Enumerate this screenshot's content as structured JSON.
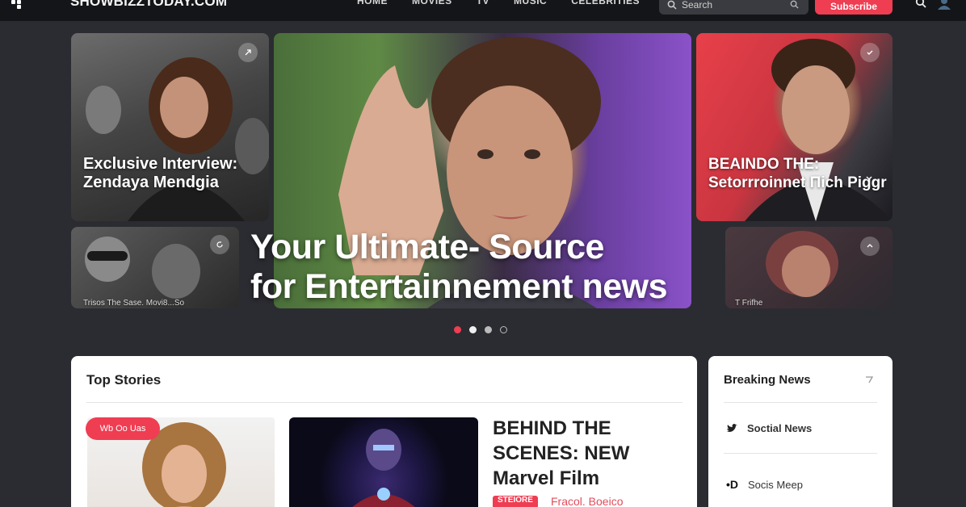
{
  "header": {
    "brand": "SHOWBIZZTODAY.COM",
    "nav": [
      "HOME",
      "MOVIES",
      "TV",
      "MUSIC",
      "CELEBRITIES"
    ],
    "search_placeholder": "Search",
    "subscribe_label": "Subscribe"
  },
  "hero": {
    "tiles": [
      {
        "title": "Exclusive Interview:  Zendaya Mendgia"
      },
      {
        "title": "BEAINDO THE: Setorrroinnet Πich Piggr"
      },
      {
        "caption": "Trisos The Sase. Movi8...So"
      },
      {
        "caption": "T Frifhe"
      }
    ],
    "headline_line1": "Your Ultimate- Source",
    "headline_line2": "for Entertainnement news",
    "carousel_total": 4,
    "carousel_active": 1
  },
  "top_stories": {
    "title": "Top Stories",
    "tag_pill": "Wb Oo Uas",
    "headline": "BEHIND THE SCENES: NEW Marvel Film",
    "story_tag": "STEIORE",
    "story_author": "Fracol. Boeico"
  },
  "breaking_news": {
    "title": "Breaking News",
    "items": [
      {
        "label": "Soctial News",
        "icon": "twitter-bird-icon"
      },
      {
        "label": "Socis Meep",
        "icon": "d-logo-icon"
      }
    ]
  },
  "colors": {
    "accent": "#ef3d52",
    "background": "#2b2c31",
    "topbar": "#141518"
  }
}
